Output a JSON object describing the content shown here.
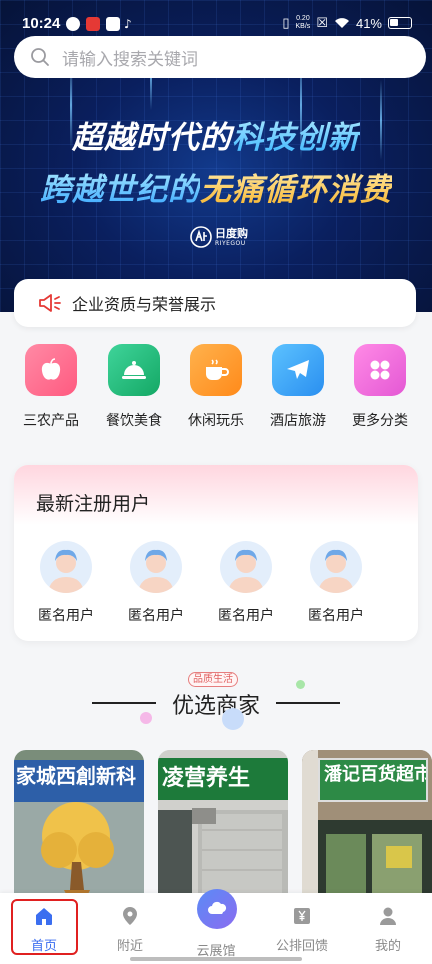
{
  "status_bar": {
    "time": "10:24",
    "net_speed_value": "0.20",
    "net_speed_unit": "KB/s",
    "battery": "41%"
  },
  "search": {
    "placeholder": "请输入搜索关键词"
  },
  "banner": {
    "line1_a": "超越时代的",
    "line1_b": "科技创新",
    "line2_a": "跨越世纪的",
    "line2_b": "无痛循环消费",
    "logo_cn": "日度购",
    "logo_en": "RIYEGOU"
  },
  "notice": {
    "text": "企业资质与荣誉展示"
  },
  "categories": [
    {
      "label": "三农产品",
      "icon": "apple-icon",
      "color": "#ff6b8a"
    },
    {
      "label": "餐饮美食",
      "icon": "food-cloche-icon",
      "color": "#1fbf7a"
    },
    {
      "label": "休闲玩乐",
      "icon": "coffee-cup-icon",
      "color": "#ff9b2f"
    },
    {
      "label": "酒店旅游",
      "icon": "airplane-icon",
      "color": "#3aa9f5"
    },
    {
      "label": "更多分类",
      "icon": "grid-dots-icon",
      "color": "#f06bd6"
    }
  ],
  "new_users": {
    "title": "最新注册用户",
    "users": [
      {
        "name": "匿名用户"
      },
      {
        "name": "匿名用户"
      },
      {
        "name": "匿名用户"
      },
      {
        "name": "匿名用户"
      }
    ]
  },
  "section": {
    "badge": "品质生活",
    "title": "优选商家"
  },
  "merchants": [
    {
      "sign": "家城西創新科"
    },
    {
      "sign": "凌营养生"
    },
    {
      "sign": "潘记百货超市"
    }
  ],
  "nav": {
    "items": [
      {
        "label": "首页",
        "icon": "home-icon",
        "active": true
      },
      {
        "label": "附近",
        "icon": "location-pin-icon",
        "active": false
      },
      {
        "label": "云展馆",
        "icon": "cloud-icon",
        "active": false
      },
      {
        "label": "公排回馈",
        "icon": "yen-box-icon",
        "active": false
      },
      {
        "label": "我的",
        "icon": "user-icon",
        "active": false
      }
    ],
    "active_color": "#3b6ef0"
  }
}
